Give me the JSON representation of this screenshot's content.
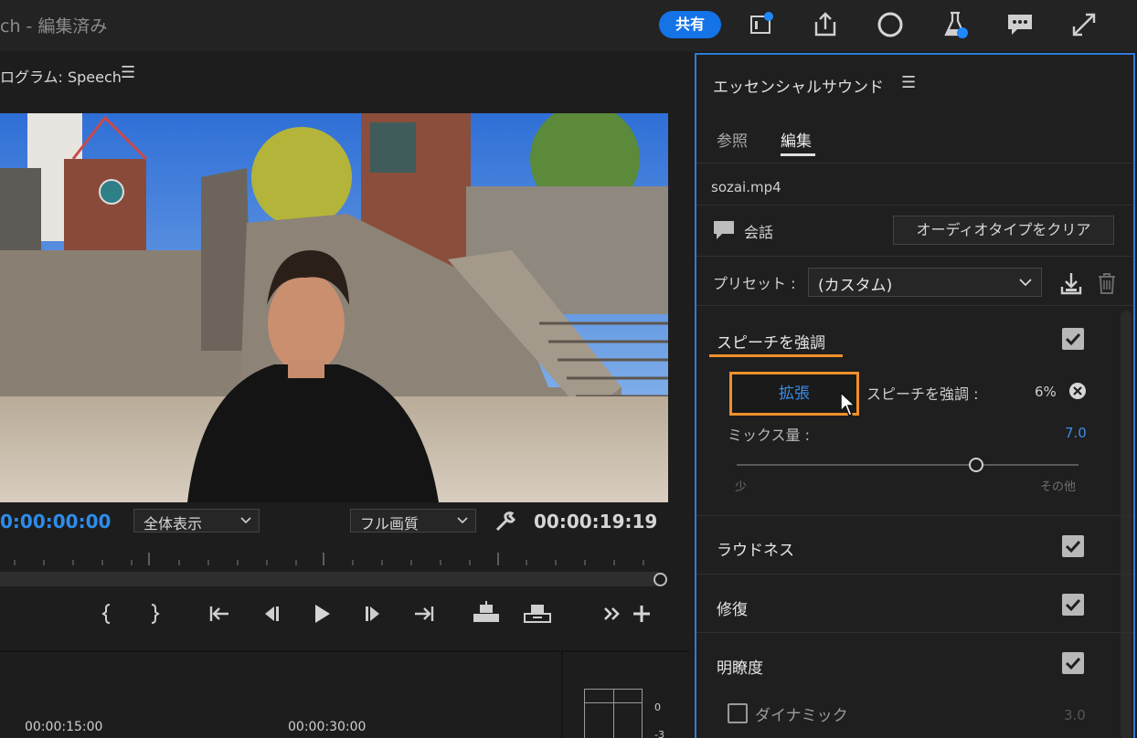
{
  "app": {
    "title": "ch - 編集済み",
    "share_label": "共有",
    "icons": [
      "quick-export-icon",
      "export-icon",
      "progress-circle-icon",
      "beta-flask-icon",
      "feedback-icon",
      "fullscreen-icon"
    ],
    "accent_color": "#1473e6"
  },
  "program_monitor": {
    "title": "ログラム: Speech",
    "menu_glyph": "☰",
    "timecode_current": "0:00:00:00",
    "fit_option": "全体表示",
    "quality_option": "フル画質",
    "timecode_duration": "00:00:19:19"
  },
  "timeline": {
    "ruler_times": [
      "00:00:15:00",
      "00:00:30:00"
    ],
    "meter_labels": [
      "0",
      "-3"
    ]
  },
  "essential_sound": {
    "title": "エッセンシャルサウンド",
    "menu_glyph": "☰",
    "tabs": [
      {
        "label": "参照",
        "active": false
      },
      {
        "label": "編集",
        "active": true
      }
    ],
    "clip_name": "sozai.mp4",
    "audio_type": "会話",
    "clear_audio_type_label": "オーディオタイプをクリア",
    "preset_label": "プリセット :",
    "preset_value": "(カスタム)",
    "sections": {
      "enhance_speech": {
        "title": "スピーチを強調",
        "checked": true,
        "expand_label": "拡張",
        "amount_label": "スピーチを強調 :",
        "amount_value": "6%",
        "mix_label": "ミックス量 :",
        "mix_value": "7.0",
        "mix_fraction": 0.7,
        "slider_min_label": "少",
        "slider_max_label": "その他"
      },
      "loudness": {
        "title": "ラウドネス",
        "checked": true
      },
      "repair": {
        "title": "修復",
        "checked": true
      },
      "clarity": {
        "title": "明瞭度",
        "checked": true
      },
      "dynamics": {
        "label": "ダイナミック",
        "checked": false,
        "value": "3.0"
      }
    },
    "highlight_color": "#f0902a",
    "value_color": "#3a8ee6"
  }
}
